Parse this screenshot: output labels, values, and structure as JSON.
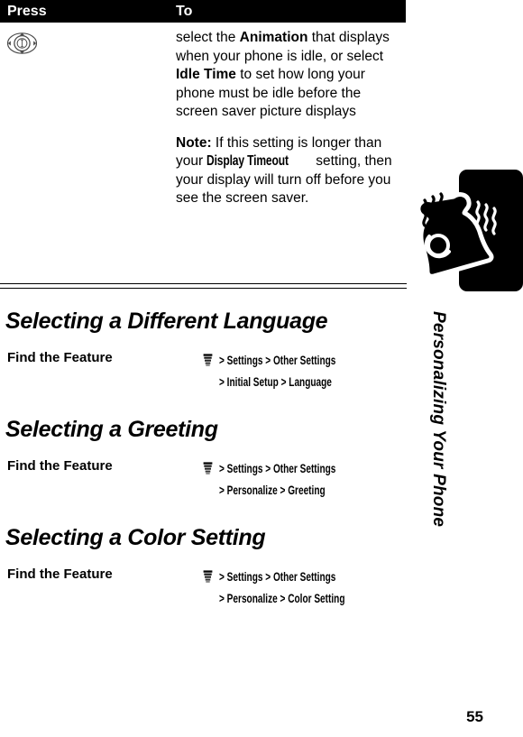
{
  "table": {
    "headers": {
      "press": "Press",
      "to": "To"
    },
    "key_icon": "navigation-key-icon",
    "paragraphs": [
      {
        "runs": [
          {
            "text": "select the ",
            "style": "normal"
          },
          {
            "text": "Animation",
            "style": "bold"
          },
          {
            "text": " that displays when your phone is idle, or select ",
            "style": "normal"
          },
          {
            "text": "Idle Time",
            "style": "bold"
          },
          {
            "text": " to set how long your phone must be idle before the screen saver picture displays",
            "style": "normal"
          }
        ]
      },
      {
        "runs": [
          {
            "text": "Note:",
            "style": "bold"
          },
          {
            "text": " If this setting is longer than your ",
            "style": "normal"
          },
          {
            "text": "Display Timeout",
            "style": "condensed-bold"
          },
          {
            "text": " setting, then your display will turn off before you see the screen saver.",
            "style": "normal"
          }
        ]
      }
    ]
  },
  "sections": [
    {
      "title": "Selecting a Different Language",
      "find_label": "Find the Feature",
      "menu_icon": "menu-icon",
      "path_line1": "> Settings > Other Settings",
      "path_line2": "> Initial Setup > Language",
      "path_items": [
        "Settings",
        "Other Settings",
        "Initial Setup",
        "Language"
      ]
    },
    {
      "title": "Selecting a Greeting",
      "find_label": "Find the Feature",
      "menu_icon": "menu-icon",
      "path_line1": "> Settings > Other Settings",
      "path_line2": "> Personalize > Greeting",
      "path_items": [
        "Settings",
        "Other Settings",
        "Personalize",
        "Greeting"
      ]
    },
    {
      "title": "Selecting a Color Setting",
      "find_label": "Find the Feature",
      "menu_icon": "menu-icon",
      "path_line1": "> Settings > Other Settings",
      "path_line2": "> Personalize > Color Setting",
      "path_items": [
        "Settings",
        "Other Settings",
        "Personalize",
        "Color Setting"
      ]
    }
  ],
  "margin": {
    "chapter_title": "Personalizing Your Phone",
    "bell_icon": "ringing-bell-icon"
  },
  "page_number": "55",
  "colors": {
    "ink": "#000000",
    "paper": "#ffffff",
    "header_bar": "#000000",
    "header_text": "#ffffff"
  }
}
